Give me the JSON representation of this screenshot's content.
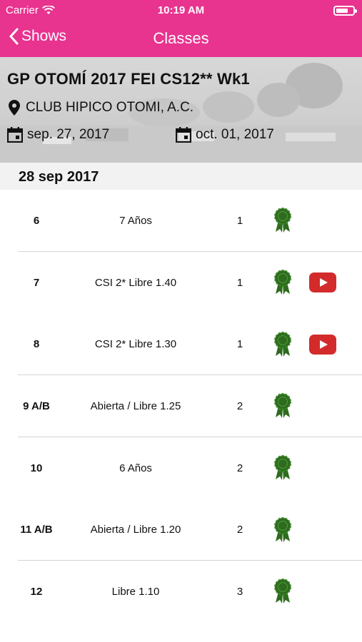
{
  "status": {
    "carrier": "Carrier",
    "time": "10:19 AM"
  },
  "nav": {
    "back_label": "Shows",
    "title": "Classes"
  },
  "show": {
    "title": "GP OTOMÍ 2017 FEI CS12** Wk1",
    "location": "CLUB HIPICO OTOMI, A.C.",
    "start_date": "sep. 27, 2017",
    "end_date": "oct. 01, 2017"
  },
  "day": {
    "label": "28 sep 2017"
  },
  "classes": [
    {
      "number": "6",
      "name": "7 Años",
      "count": "1",
      "video": false,
      "separator": true
    },
    {
      "number": "7",
      "name": "CSI 2* Libre 1.40",
      "count": "1",
      "video": true,
      "separator": false
    },
    {
      "number": "8",
      "name": "CSI 2* Libre 1.30",
      "count": "1",
      "video": true,
      "separator": true
    },
    {
      "number": "9 A/B",
      "name": "Abierta / Libre 1.25",
      "count": "2",
      "video": false,
      "separator": true
    },
    {
      "number": "10",
      "name": "6 Años",
      "count": "2",
      "video": false,
      "separator": false
    },
    {
      "number": "11 A/B",
      "name": "Abierta / Libre 1.20",
      "count": "2",
      "video": false,
      "separator": true
    },
    {
      "number": "12",
      "name": "Libre 1.10",
      "count": "3",
      "video": false,
      "separator": false
    }
  ],
  "colors": {
    "accent": "#e8338f",
    "ribbon": "#2e6b1f",
    "video": "#d32b2b"
  },
  "icons": {
    "back": "chevron-left-icon",
    "location": "map-pin-icon",
    "calendar": "calendar-icon",
    "ribbon": "award-ribbon-icon",
    "video": "youtube-play-icon"
  }
}
